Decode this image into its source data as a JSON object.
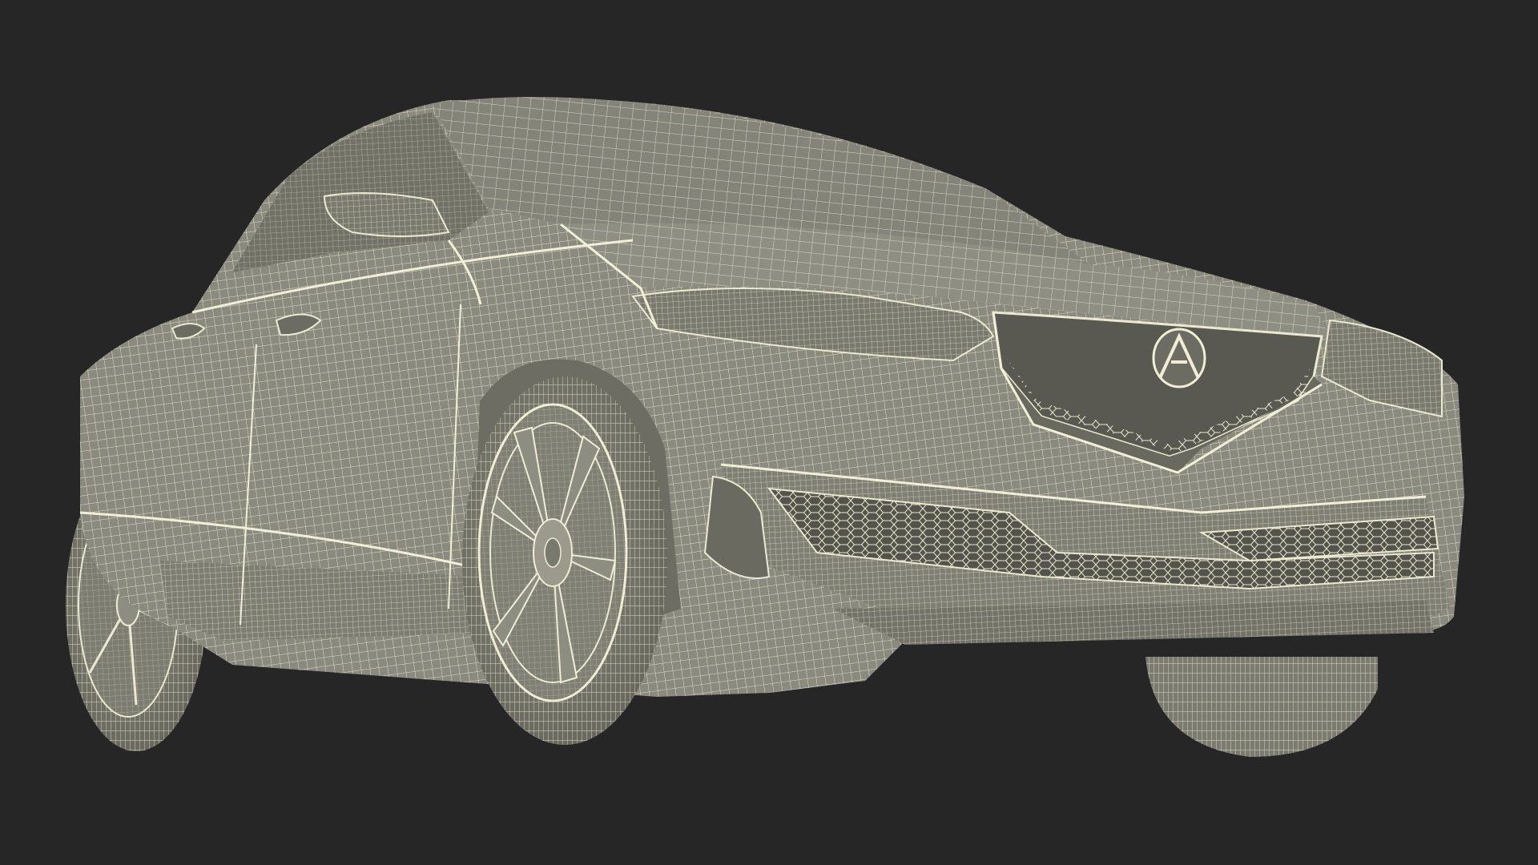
{
  "scene": {
    "subject": "car-wireframe-render",
    "colors": {
      "background": "#262626",
      "body_fill": "#8c8b7e",
      "body_shade": "#6f6e63",
      "wire_light": "#e9e6cf",
      "wire_dark": "#5f5e55",
      "opening_dark": "#4b4a43"
    }
  }
}
